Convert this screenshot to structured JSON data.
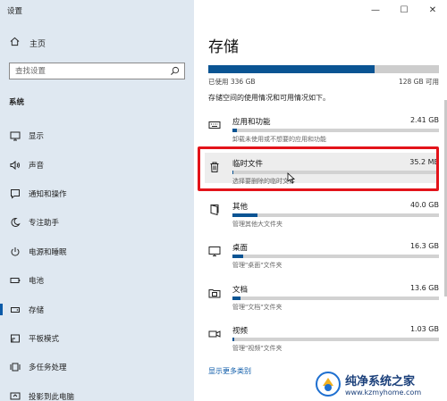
{
  "window": {
    "title": "设置",
    "controls": {
      "minimize": "—",
      "maximize": "☐",
      "close": "✕"
    }
  },
  "sidebar": {
    "home_label": "主页",
    "search_placeholder": "查找设置",
    "section_title": "系统",
    "items": [
      {
        "label": "显示",
        "icon": "monitor-icon"
      },
      {
        "label": "声音",
        "icon": "speaker-icon"
      },
      {
        "label": "通知和操作",
        "icon": "notification-icon"
      },
      {
        "label": "专注助手",
        "icon": "moon-icon"
      },
      {
        "label": "电源和睡眠",
        "icon": "power-icon"
      },
      {
        "label": "电池",
        "icon": "battery-icon"
      },
      {
        "label": "存储",
        "icon": "storage-icon",
        "active": true
      },
      {
        "label": "平板模式",
        "icon": "tablet-icon"
      },
      {
        "label": "多任务处理",
        "icon": "multitask-icon"
      },
      {
        "label": "投影到此电脑",
        "icon": "project-icon"
      }
    ]
  },
  "main": {
    "title": "存储",
    "used_label": "已使用 336 GB",
    "total_label": "128 GB 可用",
    "used_fraction": 0.72,
    "description": "存储空间的使用情况和可用情况如下。",
    "accent_color": "#0a5493",
    "categories": [
      {
        "name": "应用和功能",
        "size": "2.41 GB",
        "sub": "卸载未使用或不想要的应用和功能",
        "fill": 0.02,
        "icon": "keyboard-icon"
      },
      {
        "name": "临时文件",
        "size": "35.2 MB",
        "sub": "选择要删除的临时文件",
        "fill": 0.0,
        "icon": "trash-icon",
        "highlighted": true
      },
      {
        "name": "其他",
        "size": "40.0 GB",
        "sub": "管理其他大文件夹",
        "fill": 0.12,
        "icon": "folder-icon"
      },
      {
        "name": "桌面",
        "size": "16.3 GB",
        "sub": "管理\"桌面\"文件夹",
        "fill": 0.05,
        "icon": "desktop-icon"
      },
      {
        "name": "文档",
        "size": "13.6 GB",
        "sub": "管理\"文档\"文件夹",
        "fill": 0.04,
        "icon": "documents-icon"
      },
      {
        "name": "视频",
        "size": "1.03 GB",
        "sub": "管理\"视频\"文件夹",
        "fill": 0.01,
        "icon": "video-icon"
      }
    ],
    "more_link": "显示更多类别"
  },
  "watermark": {
    "name": "纯净系统之家",
    "url": "www.kzmyhome.com"
  }
}
